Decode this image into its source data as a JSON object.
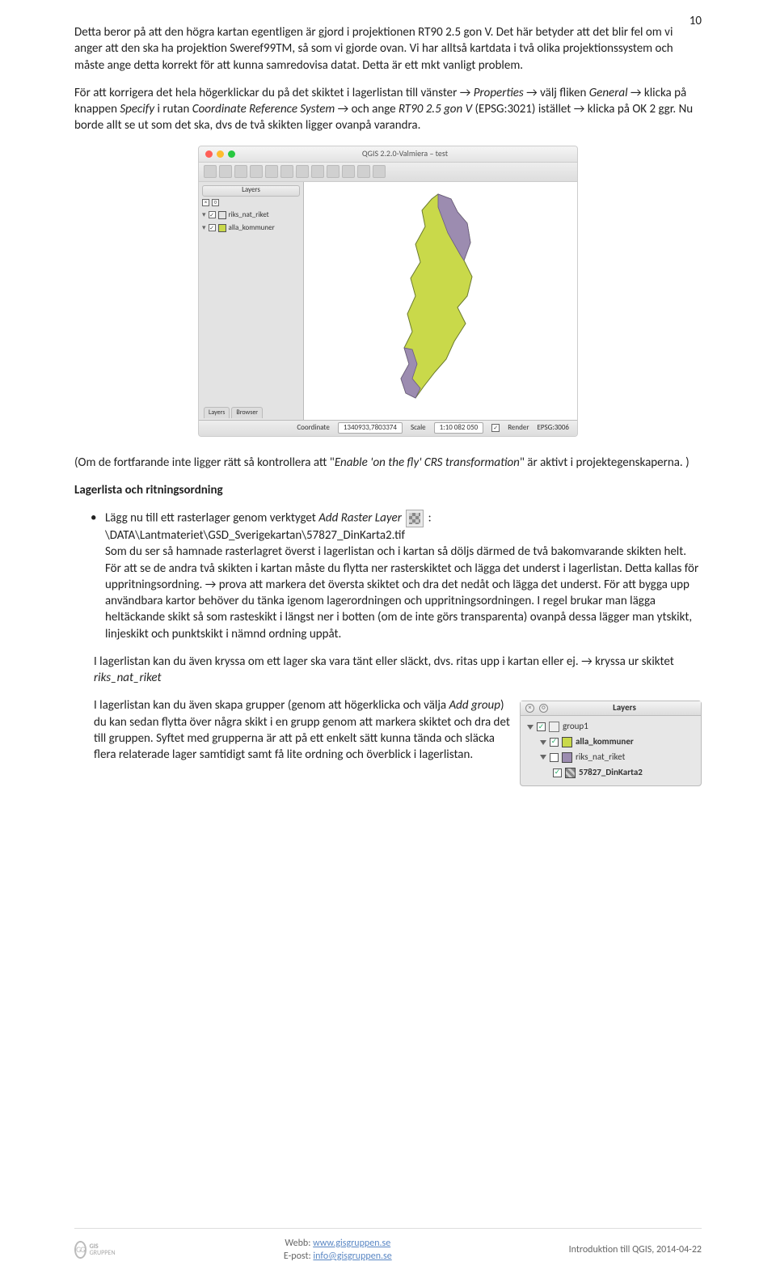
{
  "page_number": "10",
  "p1": {
    "t1": "Detta beror på att den högra kartan egentligen är gjord i projektionen RT90 2.5 gon V. Det här betyder att det blir fel om vi anger att den ska ha projektion Sweref99TM, så som vi gjorde ovan. Vi har alltså kartdata i två olika projektionssystem och måste ange detta korrekt för att kunna samredovisa datat. Detta är ett mkt vanligt problem.",
    "t2a": "För att korrigera det hela högerklickar du på det skiktet i lagerlistan till vänster ",
    "t2b": " Properties ",
    "t2c": " välj fliken ",
    "t2d": "General ",
    "t2e": " klicka på knappen ",
    "t2f": "Specify",
    "t2g": " i rutan ",
    "t2h": "Coordinate Reference System ",
    "t2i": " och ange ",
    "t2j": "RT90 2.5 gon V",
    "t2k": " (EPSG:3021) istället ",
    "t2l": " klicka på OK 2 ggr. Nu borde allt se ut som det ska, dvs de två skikten ligger ovanpå varandra."
  },
  "screenshot1": {
    "window_title": "QGIS 2.2.0-Valmiera – test",
    "panel_title": "Layers",
    "layer1": "riks_nat_riket",
    "layer2": "alla_kommuner",
    "tab1": "Layers",
    "tab2": "Browser",
    "coord_label": "Coordinate",
    "coord_value": "1340933,7803374",
    "scale_label": "Scale",
    "scale_value": "1:10 082 050",
    "render": "Render",
    "epsg": "EPSG:3006",
    "swatch1": "#9c8cb0",
    "swatch2": "#c9d94a"
  },
  "p2": {
    "t1a": "(Om de fortfarande inte ligger rätt så kontrollera att \"",
    "t1b": "Enable 'on the fly' CRS transformation",
    "t1c": "\" är aktivt i projektegenskaperna. )"
  },
  "h1": "Lagerlista och ritningsordning",
  "bullet1": {
    "t1": "Lägg nu till ett rasterlager genom verktyget ",
    "t2": "Add Raster Layer",
    "t3": " :",
    "path": "\\DATA\\Lantmateriet\\GSD_Sverigekartan\\57827_DinKarta2.tif",
    "body": "Som du ser så hamnade rasterlagret överst i lagerlistan och i kartan så döljs därmed de två bakomvarande skikten helt. För att se de andra två skikten i kartan måste du flytta ner rasterskiktet och lägga det underst i lagerlistan. Detta kallas för uppritningsordning. ",
    "body2": " prova att markera det översta skiktet och dra det nedåt och lägga det underst. För att bygga upp användbara kartor behöver du tänka igenom lagerordningen och uppritningsordningen. I regel brukar man lägga heltäckande skikt så som rasteskikt i längst ner i botten (om de inte görs transparenta) ovanpå dessa lägger man ytskikt, linjeskikt och punktskikt i nämnd ordning uppåt."
  },
  "p3a": "I lagerlistan kan du även kryssa om ett lager ska vara tänt eller släckt, dvs. ritas upp i kartan eller ej. ",
  "p3b": " kryssa ur skiktet ",
  "p3c": "riks_nat_riket",
  "panel2": {
    "title": "Layers",
    "group": "group1",
    "l1": "alla_kommuner",
    "l2": "riks_nat_riket",
    "l3": "57827_DinKarta2",
    "sw1": "#c9d94a",
    "sw2": "#9c8cb0"
  },
  "p4": "I lagerlistan kan du även skapa grupper (genom att högerklicka och välja ",
  "p4b": "Add group",
  "p4c": ") du kan sedan flytta över några skikt i en grupp genom att markera skiktet och dra det till gruppen. Syftet med grupperna är att på ett enkelt sätt kunna tända och släcka flera relaterade lager samtidigt samt få lite ordning och överblick i lagerlistan.",
  "footer": {
    "brand1": "GIS",
    "brand2": "GRUPPEN",
    "web_label": "Webb: ",
    "web_url": "www.gisgruppen.se",
    "mail_label": "E-post: ",
    "mail_url": "info@gisgruppen.se",
    "right": "Introduktion till QGIS, 2014-04-22"
  }
}
